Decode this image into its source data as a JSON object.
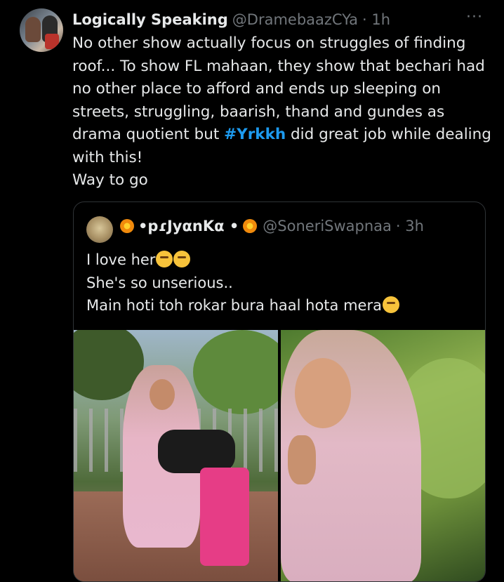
{
  "tweet": {
    "display_name": "Logically Speaking",
    "handle": "@DramebaazCYa",
    "time": "· 1h",
    "more_icon": "···",
    "text_part1": "No other show actually focus on struggles of finding roof... To show FL mahaan, they show that bechari had no other place to afford and ends up sleeping on streets, struggling, baarish, thand and gundes as drama quotient but ",
    "hashtag": "#Yrkkh",
    "text_part2": " did great job while dealing with this!",
    "text_line_last": "Way to go"
  },
  "quoted": {
    "display_name": "•pɾJyαnKα •",
    "handle": "@SoneriSwapnaa",
    "time": "· 3h",
    "line1": "I love her",
    "line2": "She's so unserious..",
    "line3": "Main hoti toh rokar bura haal hota mera"
  },
  "colors": {
    "background": "#000000",
    "text": "#e7e9ea",
    "secondary": "#71767b",
    "link": "#1d9bf0",
    "border": "#2f3336"
  },
  "icons": [
    "more-icon",
    "flower-emoji",
    "crying-laughing-emoji",
    "laughing-emoji"
  ]
}
